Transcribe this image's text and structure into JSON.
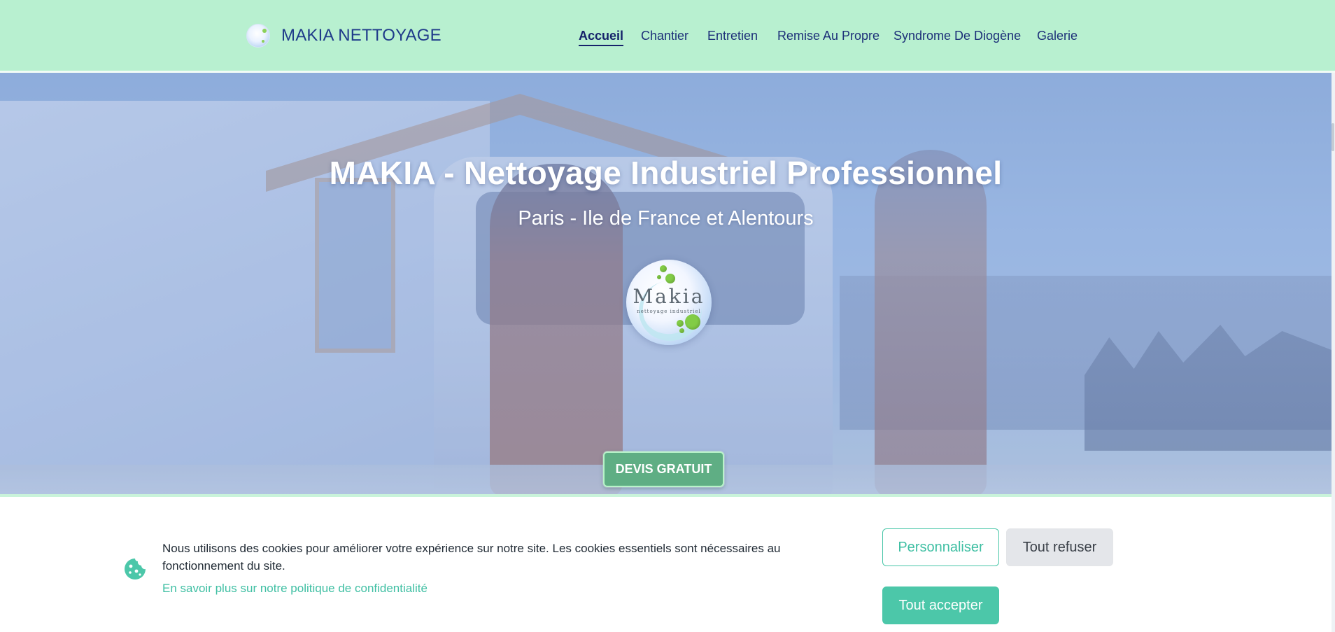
{
  "brand": {
    "name": "MAKIA NETTOYAGE",
    "logo_icon": "makia-logo"
  },
  "nav": {
    "items": [
      {
        "label": "Accueil",
        "active": true
      },
      {
        "label": "Chantier",
        "active": false
      },
      {
        "label": "Entretien",
        "active": false
      },
      {
        "label": "Remise Au Propre",
        "active": false
      },
      {
        "label": "Syndrome De Diogène",
        "active": false
      },
      {
        "label": "Galerie",
        "active": false
      }
    ]
  },
  "hero": {
    "title": "MAKIA - Nettoyage Industriel Professionnel",
    "subtitle": "Paris - Ile de France et Alentours",
    "logo_word": "Makia",
    "logo_tagline": "nettoyage industriel",
    "cta_label": "DEVIS GRATUIT"
  },
  "cookie_banner": {
    "icon": "cookie-icon",
    "text": "Nous utilisons des cookies pour améliorer votre expérience sur notre site. Les cookies essentiels sont nécessaires au fonctionnement du site.",
    "policy_link": "En savoir plus sur notre politique de confidentialité",
    "buttons": {
      "customize": "Personnaliser",
      "refuse": "Tout refuser",
      "accept": "Tout accepter"
    }
  },
  "colors": {
    "header_bg": "#b8f0d0",
    "nav_text": "#1c2f78",
    "accent": "#4cc7a9",
    "cta_bg": "#5fae84"
  }
}
